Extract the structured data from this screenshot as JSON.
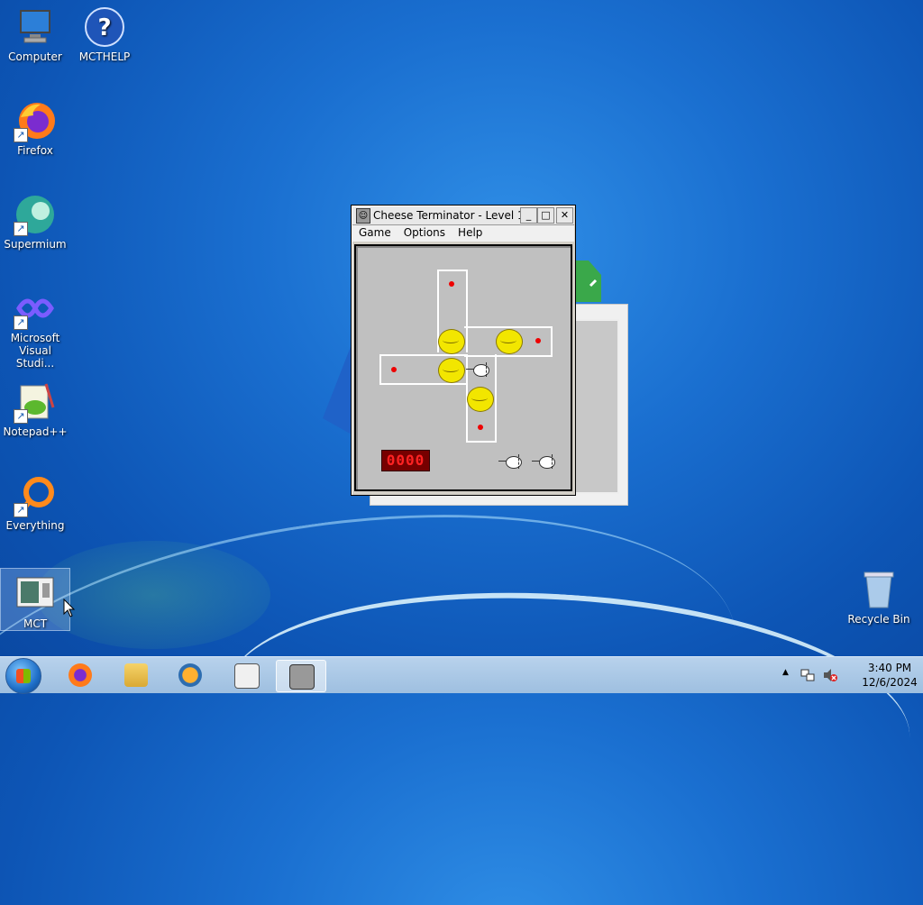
{
  "desktop": {
    "icons": [
      {
        "label": "Computer"
      },
      {
        "label": "MCTHELP",
        "glyph": "?"
      },
      {
        "label": "Firefox"
      },
      {
        "label": "Supermium"
      },
      {
        "label": "Microsoft Visual Studi..."
      },
      {
        "label": "Notepad++"
      },
      {
        "label": "Everything"
      },
      {
        "label": "MCT"
      },
      {
        "label": "Recycle Bin"
      }
    ]
  },
  "window": {
    "title": "Cheese Terminator - Level 1",
    "title_icon": "mouse-face-icon",
    "buttons": {
      "minimize": "_",
      "maximize": "□",
      "close": "✕"
    },
    "menu": [
      "Game",
      "Options",
      "Help"
    ],
    "score_display": "0000"
  },
  "taskbar": {
    "apps": [
      "firefox",
      "file-explorer",
      "media-player",
      "mct",
      "cheese-terminator"
    ],
    "tray_chevron": "▲",
    "time": "3:40 PM",
    "date": "12/6/2024"
  },
  "colors": {
    "desktop_blue": "#1a6fd0",
    "cheese_yellow": "#f2e600",
    "board_gray": "#c0c0c0",
    "counter_red": "#ff2222"
  }
}
